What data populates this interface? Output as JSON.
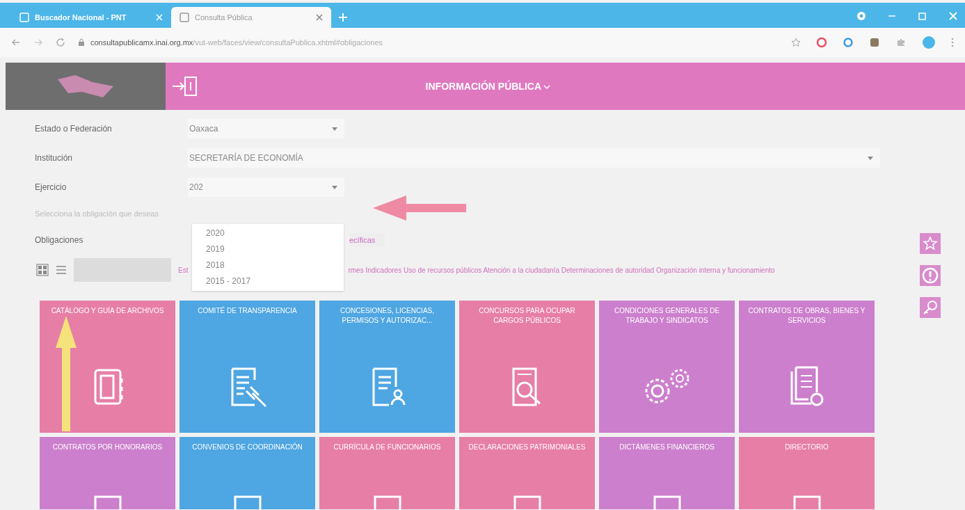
{
  "browser": {
    "tabs": [
      {
        "label": "Buscador Nacional - PNT",
        "selected": false
      },
      {
        "label": "Consulta Pública",
        "selected": true
      }
    ],
    "address": "**consultapublicamx.inai.org.mx**/vut-web/faces/view/consultaPublica.xhtml#obligaciones"
  },
  "header": {
    "title": "INFORMACIÓN PÚBLICA"
  },
  "form": {
    "fields": [
      {
        "label": "Estado o Federación",
        "value": "Oaxaca",
        "kind": "short"
      },
      {
        "label": "Institución",
        "value": "SECRETARÍA DE ECONOMÍA",
        "kind": "long"
      },
      {
        "label": "Ejercicio",
        "value": "202",
        "kind": "short"
      }
    ],
    "hint": "Selecciona la obligación que deseas",
    "obligations_label": "Obligaciones",
    "link_fragment": "ecíficas",
    "filter_start": "Est",
    "filter_rest": "rmes Indicadores Uso de recursos públicos Atención a la ciudadanía Determinaciones de autoridad Organización interna y funcionamiento",
    "dropdown_options": [
      "2020",
      "2019",
      "2018",
      "2015 - 2017"
    ]
  },
  "tiles": [
    {
      "label": "CATÁLOGO Y GUÍA DE ARCHIVOS",
      "color": "#e77ea6",
      "kind": "binder"
    },
    {
      "label": "COMITÉ DE TRANSPARENCIA",
      "color": "#4ea6e2",
      "kind": "gavel"
    },
    {
      "label": "CONCESIONES, LICENCIAS, PERMISOS Y AUTORIZAC...",
      "color": "#4ea6e2",
      "kind": "permit"
    },
    {
      "label": "CONCURSOS PARA OCUPAR CARGOS PÚBLICOS",
      "color": "#e77ea6",
      "kind": "search"
    },
    {
      "label": "CONDICIONES GENERALES DE TRABAJO Y SINDICATOS",
      "color": "#cc7fcc",
      "kind": "gears"
    },
    {
      "label": "CONTRATOS DE OBRAS, BIENES Y SERVICIOS",
      "color": "#cc7fcc",
      "kind": "documents"
    },
    {
      "label": "CONTRATOS POR HONORARIOS",
      "color": "#cc7fcc",
      "kind": "partial"
    },
    {
      "label": "CONVENIOS DE COORDINACIÓN",
      "color": "#4ea6e2",
      "kind": "partial"
    },
    {
      "label": "CURRÍCULA DE FUNCIONARIOS",
      "color": "#e77ea6",
      "kind": "partial"
    },
    {
      "label": "DECLARACIONES PATRIMONIALES",
      "color": "#e77ea6",
      "kind": "partial"
    },
    {
      "label": "DICTÁMENES FINANCIEROS",
      "color": "#cc7fcc",
      "kind": "partial"
    },
    {
      "label": "DIRECTORIO",
      "color": "#e77ea6",
      "kind": "partial"
    }
  ]
}
